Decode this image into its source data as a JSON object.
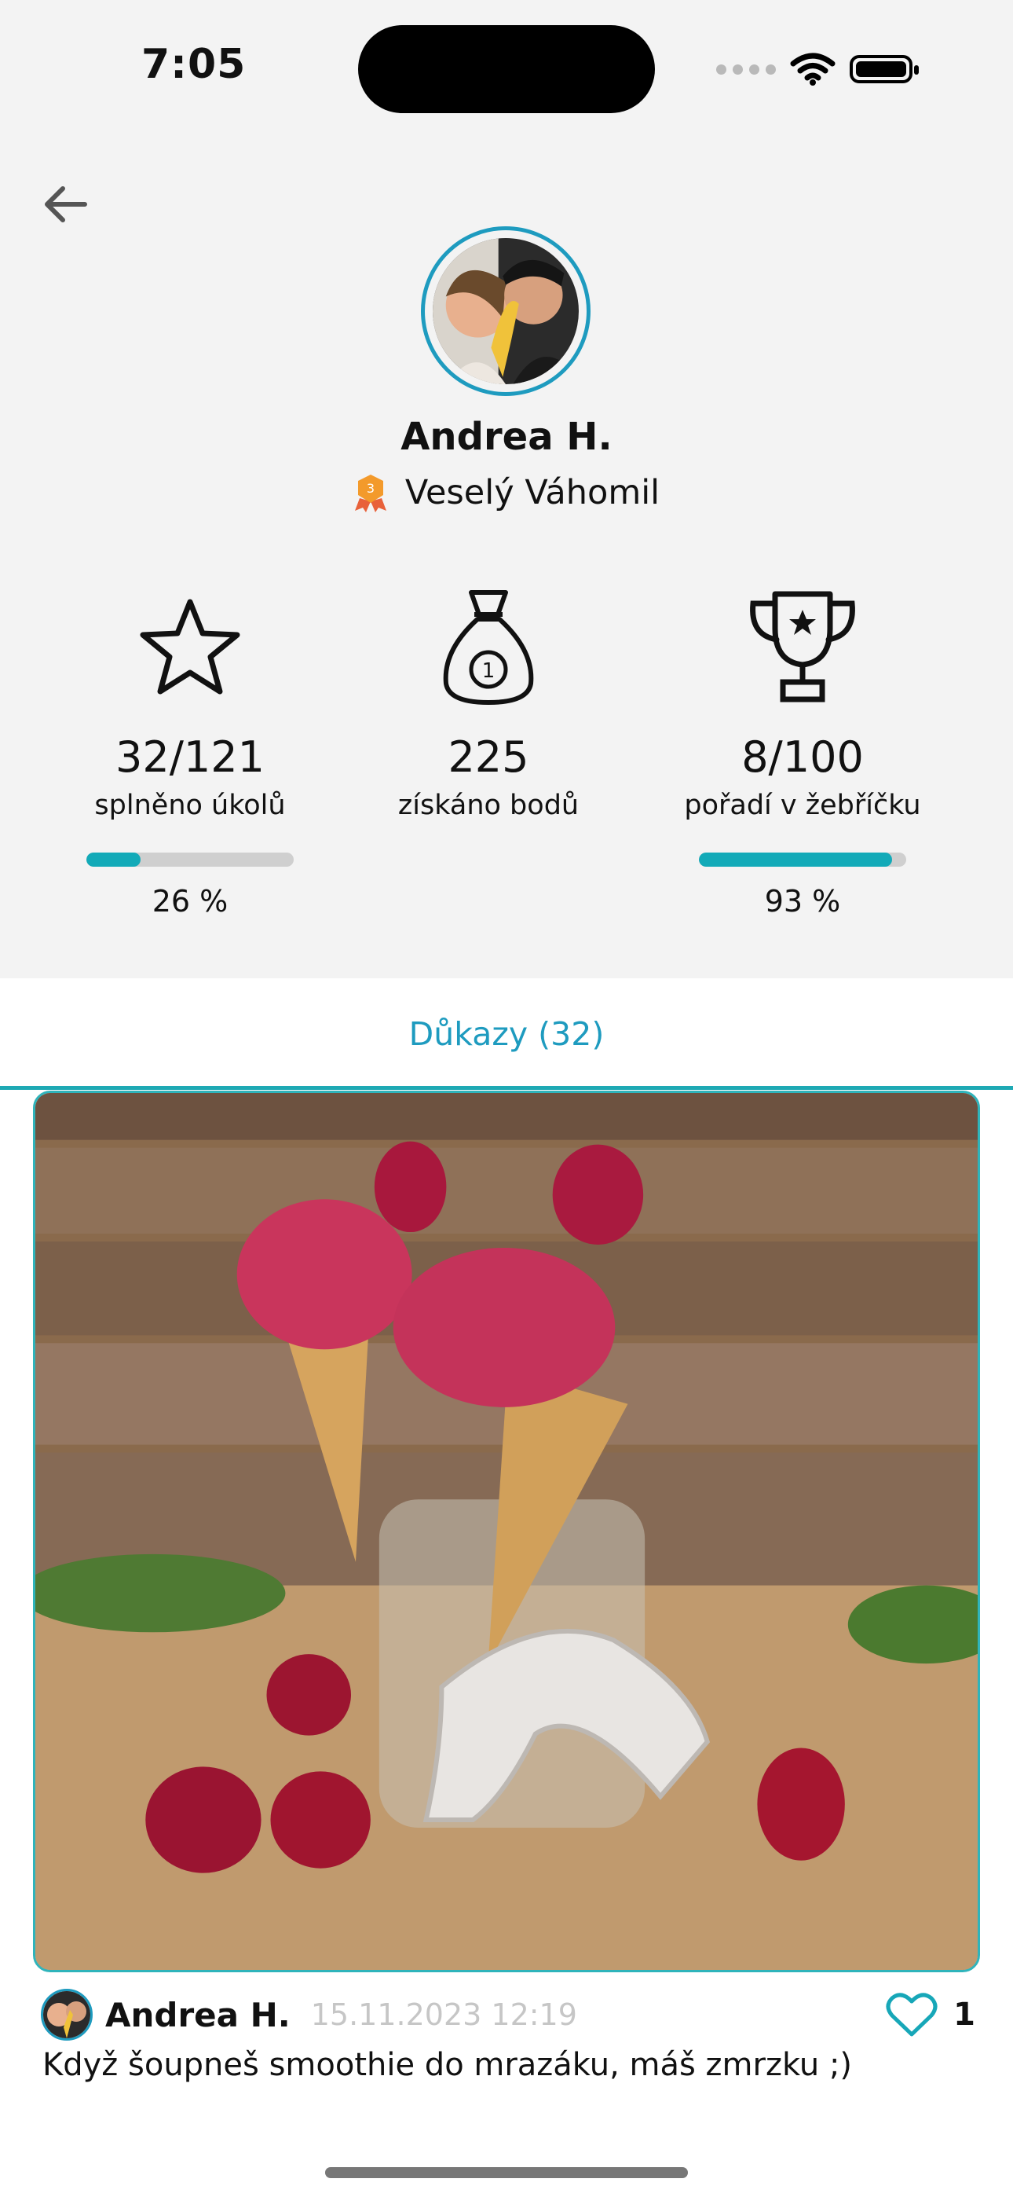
{
  "status_bar": {
    "time": "7:05"
  },
  "profile": {
    "name": "Andrea H.",
    "level_title": "Veselý Váhomil",
    "level_badge_number": "3"
  },
  "stats": {
    "tasks": {
      "value": "32/121",
      "label": "splněno úkolů",
      "progress_text": "26 %",
      "progress": 26
    },
    "points": {
      "value": "225",
      "label": "získáno bodů",
      "bag_number": "1"
    },
    "rank": {
      "value": "8/100",
      "label": "pořadí v žebříčku",
      "progress_text": "93 %",
      "progress": 93
    }
  },
  "tabs": {
    "proofs_label": "Důkazy (32)"
  },
  "post": {
    "author": "Andrea H.",
    "datetime": "15.11.2023 12:19",
    "likes": "1",
    "caption": "Když šoupneš smoothie do mrazáku, máš zmrzku ;)"
  },
  "colors": {
    "accent": "#12aab8",
    "avatar_ring": "#1e9bbf",
    "header_bg": "#f3f3f3"
  },
  "icons": [
    "arrow-left-icon",
    "wifi-icon",
    "battery-icon",
    "medal-icon",
    "star-icon",
    "money-bag-icon",
    "trophy-icon",
    "heart-icon"
  ]
}
